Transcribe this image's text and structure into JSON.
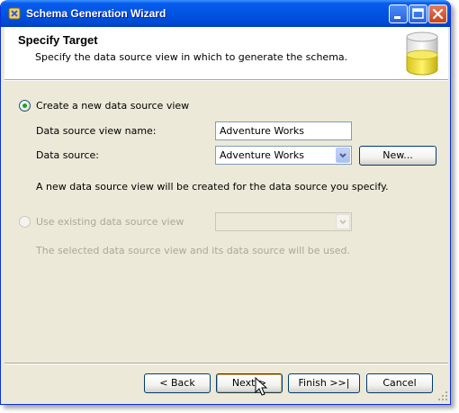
{
  "window": {
    "title": "Schema Generation Wizard"
  },
  "header": {
    "title": "Specify Target",
    "subtitle": "Specify the data source view in which to generate the schema."
  },
  "options": {
    "create_new": {
      "label": "Create a new data source view",
      "selected": true,
      "name_label": "Data source view name:",
      "name_value": "Adventure Works",
      "source_label": "Data source:",
      "source_value": "Adventure Works",
      "new_button": "New...",
      "note": "A new data source view will be created for the data source you specify."
    },
    "use_existing": {
      "label": "Use existing data source view",
      "selected": false,
      "enabled": false,
      "note": "The selected data source view and its data source will be used."
    }
  },
  "footer": {
    "back": "< Back",
    "next": "Next >",
    "finish": "Finish >>|",
    "cancel": "Cancel"
  },
  "colors": {
    "titlebar": "#0054e3",
    "radio_dot": "#21a121",
    "disabled_text": "#aca899"
  }
}
